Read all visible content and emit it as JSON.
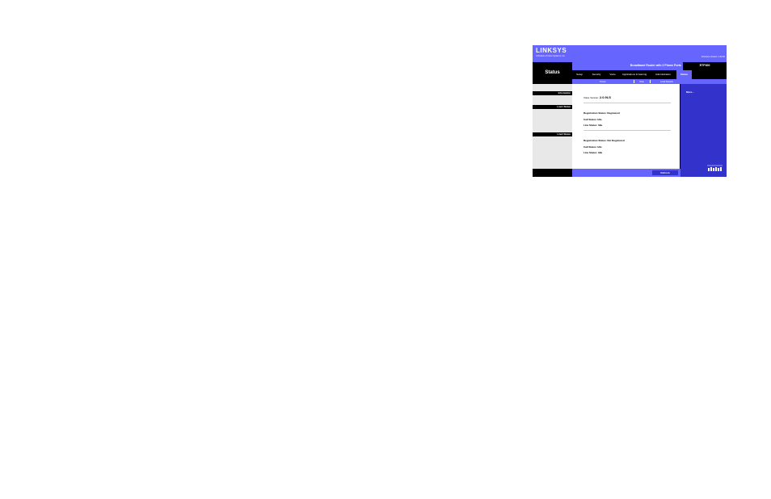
{
  "header": {
    "brand": "LINKSYS",
    "brand_sub": "A Division of Cisco Systems, Inc.",
    "top_links": "Firmware Version: 1.00.00",
    "page_section": "Status",
    "product_name": "Broadband Router with 2 Phone Ports",
    "model": "RTP300"
  },
  "tabs": [
    {
      "label": "Setup"
    },
    {
      "label": "Security"
    },
    {
      "label": "Voice"
    },
    {
      "label": "Applications & Gaming"
    },
    {
      "label": "Administration"
    },
    {
      "label": "Status"
    }
  ],
  "subtabs": [
    {
      "label": "Router"
    },
    {
      "label": "Voice"
    },
    {
      "label": "Local Network"
    }
  ],
  "sidebar": {
    "sections": [
      "Information",
      "Line1 Status",
      "Line2 Status"
    ]
  },
  "main": {
    "voice_version_label": "Voice Version:",
    "voice_version_value": "2.0.9LS",
    "line1": {
      "registration": "Registration Status: Registered",
      "call_status": "Call Status: Idle",
      "line_status": "Line Status: Idle"
    },
    "line2": {
      "registration": "Registration Status: Not Registered",
      "call_status": "Call Status: Idle",
      "line_status": "Line Status: Idle"
    }
  },
  "help": {
    "title": "More..."
  },
  "buttons": {
    "refresh": "Refresh"
  },
  "colors": {
    "accent": "#6666ff",
    "help_panel": "#3333cc",
    "dark": "#000000"
  },
  "icons": {
    "footer_logo": "cisco-systems-logo"
  }
}
